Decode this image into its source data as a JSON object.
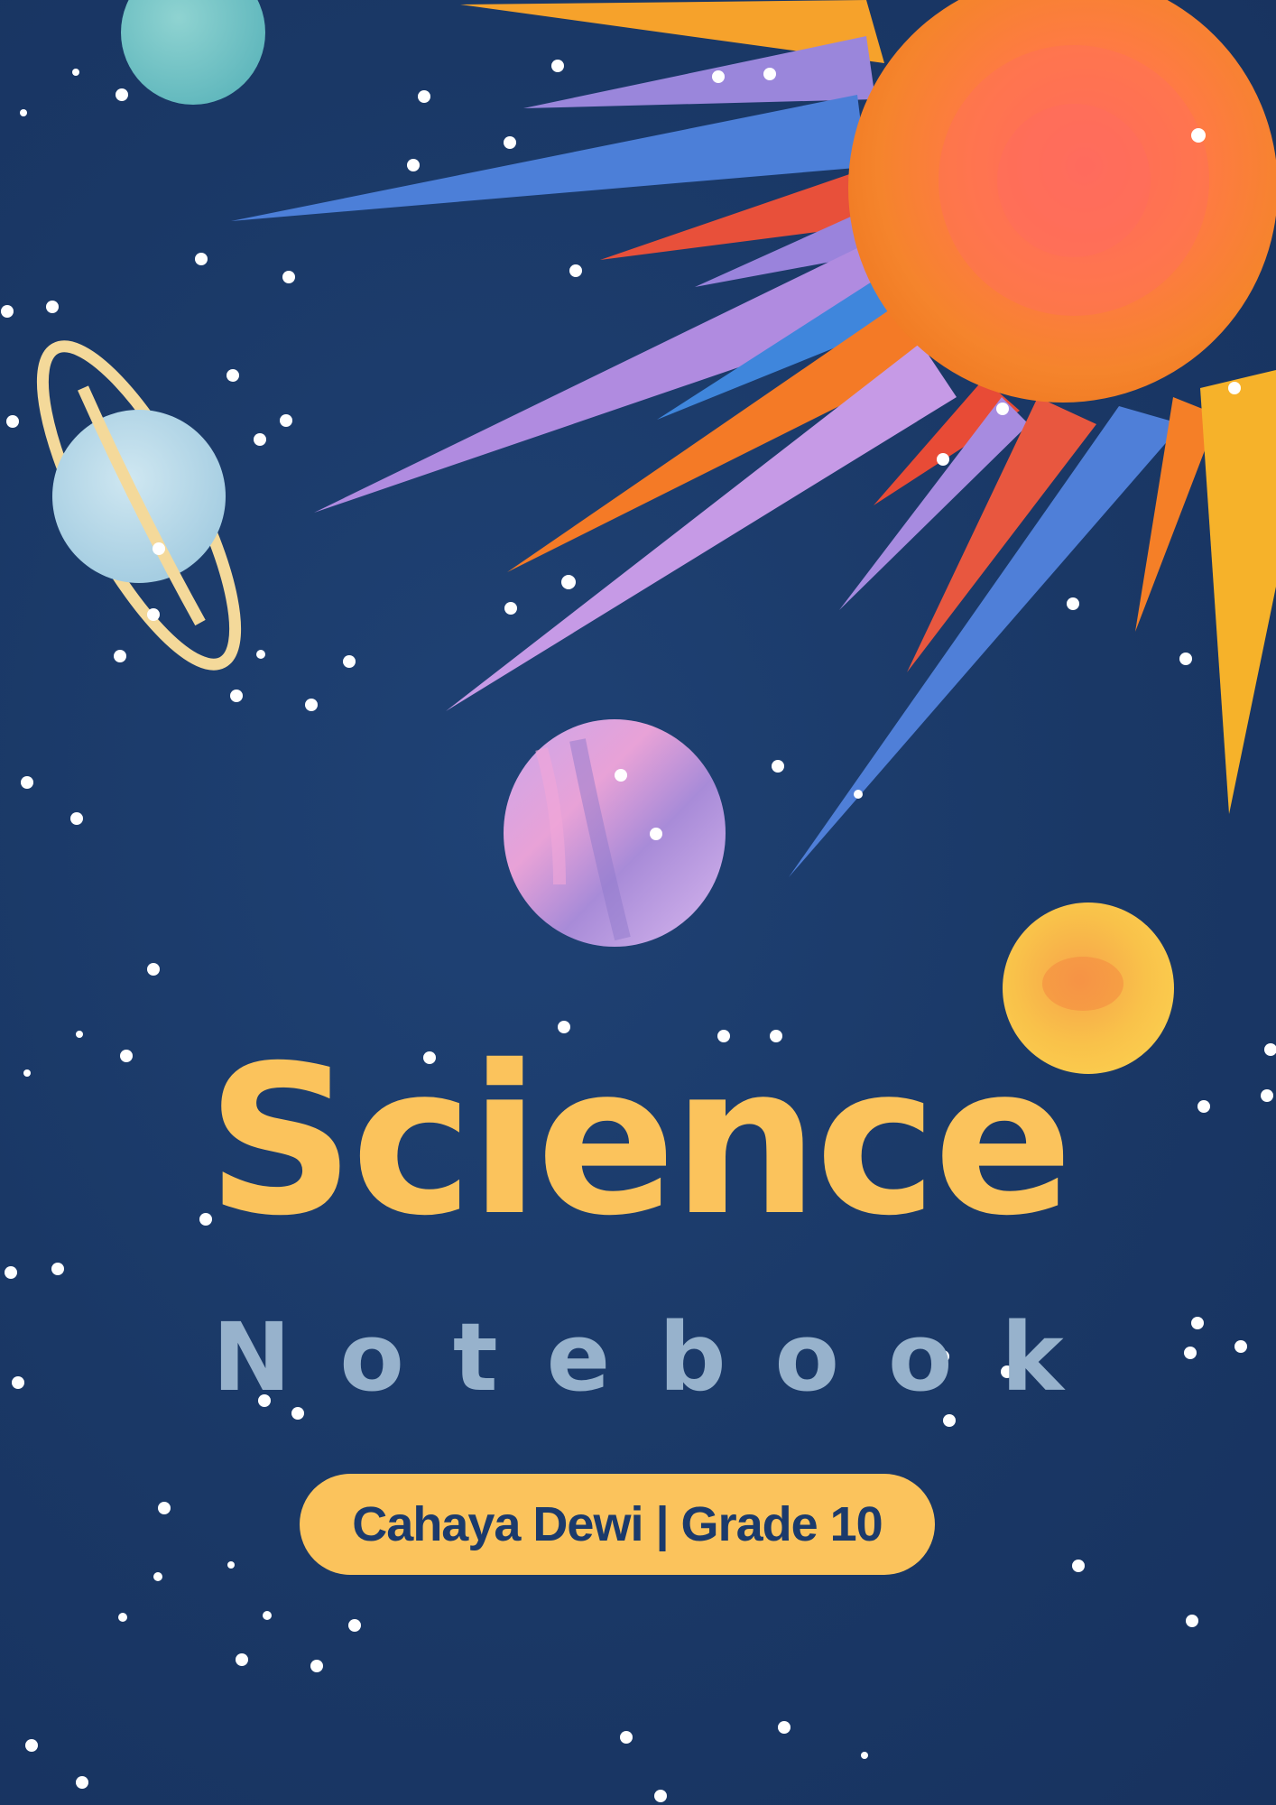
{
  "cover": {
    "title": "Science",
    "subtitle": "Notebook",
    "byline": "Cahaya Dewi | Grade 10"
  },
  "colors": {
    "background": "#1b3a6b",
    "title": "#fbc35c",
    "subtitle": "#97b2cc",
    "pill": "#fbc35c",
    "pill_text": "#1b3a6b",
    "sun_core": "#f47a2c",
    "sun_inner": "#ff6b5a"
  },
  "icons": {
    "sun": "sun-illustration",
    "ringed_planet": "ringed-planet-illustration",
    "teal_planet": "teal-planet-illustration",
    "purple_planet": "purple-planet-illustration",
    "yellow_planet": "yellow-planet-illustration",
    "stars": "star-dots"
  }
}
